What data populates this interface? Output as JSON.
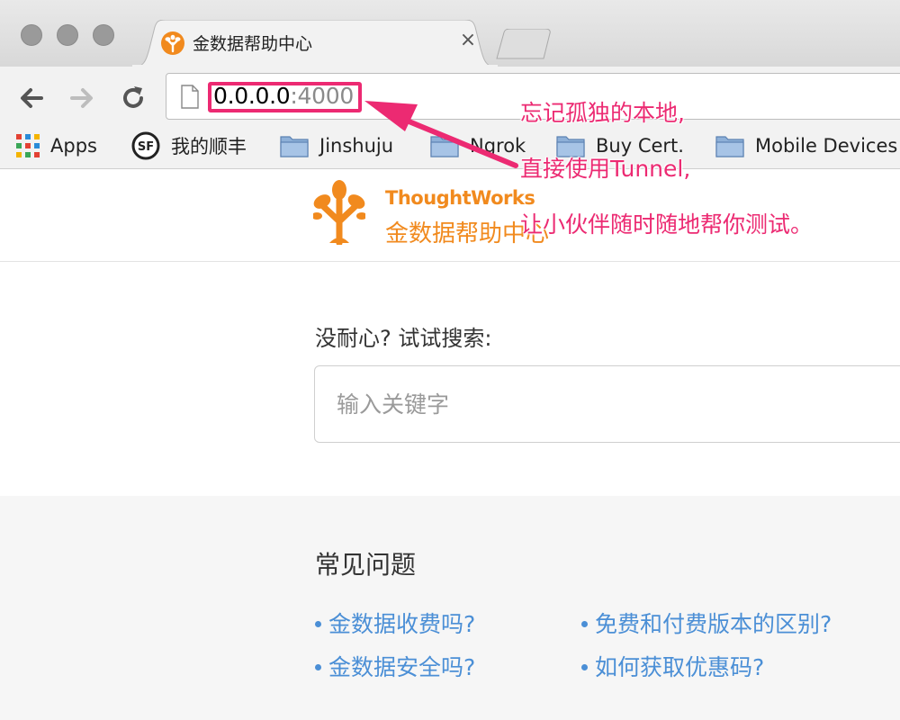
{
  "browser": {
    "tab": {
      "title": "金数据帮助中心",
      "close_glyph": "×"
    },
    "url": {
      "host": "0.0.0.0",
      "port": ":4000"
    },
    "bookmarks": [
      {
        "label": "Apps",
        "icon": "apps-grid-icon"
      },
      {
        "label": "我的顺丰",
        "icon": "sf-express-icon"
      },
      {
        "label": "Jinshuju",
        "icon": "folder-icon"
      },
      {
        "label": "Ngrok",
        "icon": "folder-icon"
      },
      {
        "label": "Buy Cert.",
        "icon": "folder-icon"
      },
      {
        "label": "Mobile Devices",
        "icon": "folder-icon"
      }
    ]
  },
  "header": {
    "brand": "ThoughtWorks",
    "subtitle": "金数据帮助中心"
  },
  "search": {
    "label": "没耐心? 试试搜索:",
    "placeholder": "输入关键字"
  },
  "faq": {
    "title": "常见问题",
    "links": [
      "金数据收费吗?",
      "免费和付费版本的区别?",
      "金数据安全吗?",
      "如何获取优惠码?"
    ]
  },
  "annotation": {
    "lines": [
      "忘记孤独的本地,",
      "直接使用Tunnel,",
      "让小伙伴随时随地帮你测试。"
    ],
    "color": "#ec2a72"
  },
  "colors": {
    "brand_orange": "#f18a1e",
    "link_blue": "#4b8fd6",
    "annotation_pink": "#ec2a72"
  }
}
